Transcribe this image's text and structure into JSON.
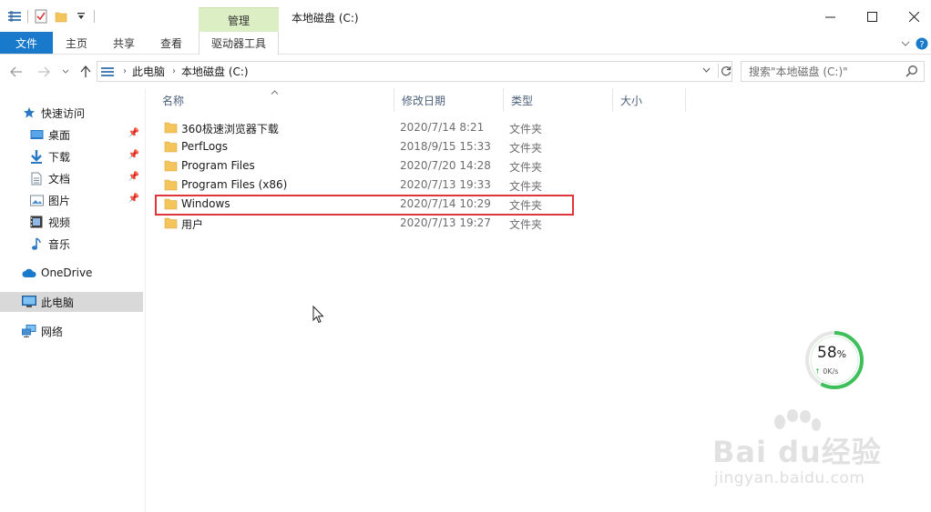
{
  "window": {
    "title": "本地磁盘 (C:)",
    "context_tab_group": "管理"
  },
  "ribbon": {
    "tabs": [
      {
        "label": "文件"
      },
      {
        "label": "主页"
      },
      {
        "label": "共享"
      },
      {
        "label": "查看"
      },
      {
        "label": "驱动器工具"
      }
    ]
  },
  "address": {
    "crumbs": [
      "此电脑",
      "本地磁盘 (C:)"
    ],
    "search_placeholder": "搜索\"本地磁盘 (C:)\""
  },
  "sidebar": {
    "items": [
      {
        "label": "快速访问",
        "icon": "star-icon"
      },
      {
        "label": "桌面",
        "icon": "desktop-icon",
        "pinned": true
      },
      {
        "label": "下载",
        "icon": "download-icon",
        "pinned": true
      },
      {
        "label": "文档",
        "icon": "document-icon",
        "pinned": true
      },
      {
        "label": "图片",
        "icon": "pictures-icon",
        "pinned": true
      },
      {
        "label": "视频",
        "icon": "video-icon"
      },
      {
        "label": "音乐",
        "icon": "music-icon"
      },
      {
        "label": "OneDrive",
        "icon": "cloud-icon"
      },
      {
        "label": "此电脑",
        "icon": "computer-icon",
        "selected": true
      },
      {
        "label": "网络",
        "icon": "network-icon"
      }
    ]
  },
  "columns": {
    "name": "名称",
    "modified": "修改日期",
    "type": "类型",
    "size": "大小"
  },
  "files": [
    {
      "name": "360极速浏览器下载",
      "modified": "2020/7/14 8:21",
      "type": "文件夹"
    },
    {
      "name": "PerfLogs",
      "modified": "2018/9/15 15:33",
      "type": "文件夹"
    },
    {
      "name": "Program Files",
      "modified": "2020/7/20 14:28",
      "type": "文件夹"
    },
    {
      "name": "Program Files (x86)",
      "modified": "2020/7/13 19:33",
      "type": "文件夹"
    },
    {
      "name": "Windows",
      "modified": "2020/7/14 10:29",
      "type": "文件夹",
      "highlighted": true
    },
    {
      "name": "用户",
      "modified": "2020/7/13 19:27",
      "type": "文件夹"
    }
  ],
  "speed_widget": {
    "percent": "58",
    "percent_unit": "%",
    "rate": "0K/s",
    "level": 0.58
  },
  "watermark": {
    "brand": "Bai du经验",
    "url": "jingyan.baidu.com"
  },
  "colors": {
    "file_tab": "#1979ca",
    "context_tab": "#dcefc4",
    "highlight": "#e0363b",
    "folder": "#f4c55a",
    "selected_nav": "#d9d9d9"
  }
}
